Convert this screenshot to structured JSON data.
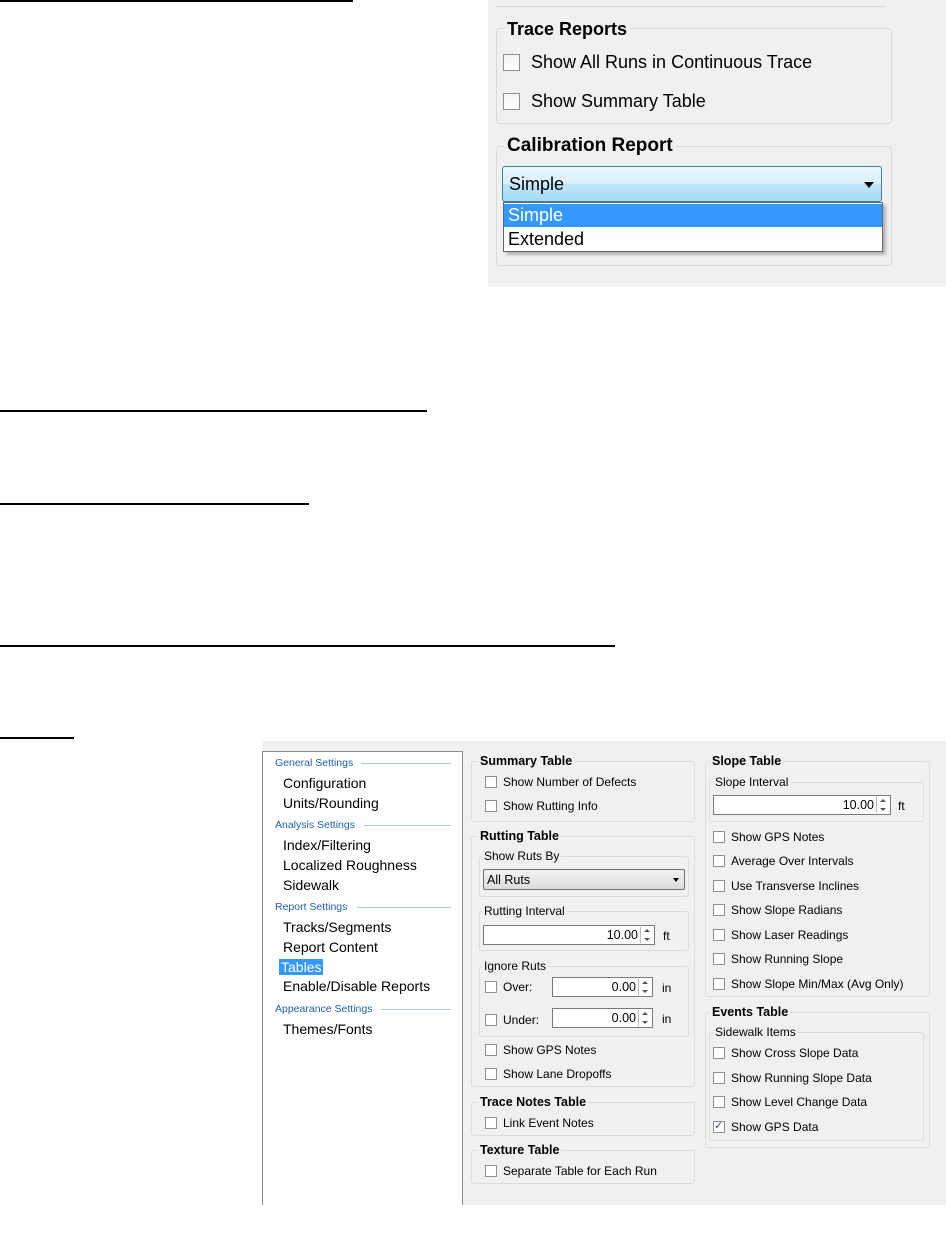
{
  "trace_dialog": {
    "trace_reports": {
      "title": "Trace Reports",
      "options": [
        {
          "label": "Show All Runs in Continuous Trace",
          "checked": false
        },
        {
          "label": "Show Summary Table",
          "checked": false
        }
      ]
    },
    "calibration_report": {
      "title": "Calibration Report",
      "selected": "Simple",
      "options": [
        "Simple",
        "Extended"
      ],
      "highlighted_option": "Simple"
    }
  },
  "settings_dialog": {
    "nav": {
      "categories": [
        {
          "label": "General Settings",
          "items": [
            "Configuration",
            "Units/Rounding"
          ]
        },
        {
          "label": "Analysis Settings",
          "items": [
            "Index/Filtering",
            "Localized Roughness",
            "Sidewalk"
          ]
        },
        {
          "label": "Report Settings",
          "items": [
            "Tracks/Segments",
            "Report Content",
            "Tables",
            "Enable/Disable Reports"
          ]
        },
        {
          "label": "Appearance Settings",
          "items": [
            "Themes/Fonts"
          ]
        }
      ],
      "selected_item": "Tables"
    },
    "summary_table": {
      "title": "Summary Table",
      "options": [
        {
          "label": "Show Number of Defects",
          "checked": false
        },
        {
          "label": "Show Rutting Info",
          "checked": false
        }
      ]
    },
    "rutting_table": {
      "title": "Rutting Table",
      "show_ruts_by": {
        "label": "Show Ruts By",
        "selected": "All Ruts"
      },
      "rutting_interval": {
        "label": "Rutting Interval",
        "value": "10.00",
        "unit": "ft"
      },
      "ignore_ruts": {
        "label": "Ignore Ruts",
        "over": {
          "label": "Over:",
          "value": "0.00",
          "unit": "in",
          "checked": false
        },
        "under": {
          "label": "Under:",
          "value": "0.00",
          "unit": "in",
          "checked": false
        }
      },
      "options": [
        {
          "label": "Show GPS Notes",
          "checked": false
        },
        {
          "label": "Show Lane Dropoffs",
          "checked": false
        }
      ]
    },
    "trace_notes_table": {
      "title": "Trace Notes Table",
      "options": [
        {
          "label": "Link Event Notes",
          "checked": false
        }
      ]
    },
    "texture_table": {
      "title": "Texture Table",
      "options": [
        {
          "label": "Separate Table for Each Run",
          "checked": false
        }
      ]
    },
    "slope_table": {
      "title": "Slope Table",
      "slope_interval": {
        "label": "Slope Interval",
        "value": "10.00",
        "unit": "ft"
      },
      "options": [
        {
          "label": "Show GPS Notes",
          "checked": false
        },
        {
          "label": "Average Over Intervals",
          "checked": false
        },
        {
          "label": "Use Transverse Inclines",
          "checked": false
        },
        {
          "label": "Show Slope Radians",
          "checked": false
        },
        {
          "label": "Show Laser Readings",
          "checked": false
        },
        {
          "label": "Show Running Slope",
          "checked": false
        },
        {
          "label": "Show Slope Min/Max (Avg Only)",
          "checked": false
        }
      ]
    },
    "events_table": {
      "title": "Events Table",
      "sidewalk_items": {
        "label": "Sidewalk Items",
        "options": [
          {
            "label": "Show Cross Slope Data",
            "checked": false
          },
          {
            "label": "Show Running Slope Data",
            "checked": false
          },
          {
            "label": "Show Level Change Data",
            "checked": false
          },
          {
            "label": "Show GPS Data",
            "checked": true
          }
        ]
      }
    }
  }
}
